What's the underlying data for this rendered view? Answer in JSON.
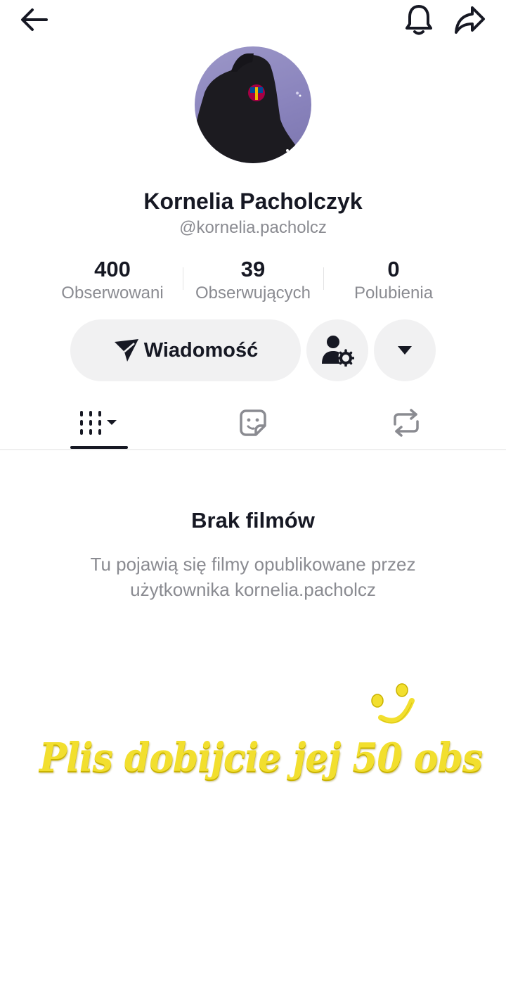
{
  "header": {
    "back_icon": "arrow-left-icon",
    "bell_icon": "bell-icon",
    "share_icon": "share-arrow-icon"
  },
  "profile": {
    "display_name": "Kornelia Pacholczyk",
    "username": "@kornelia.pacholcz"
  },
  "stats": [
    {
      "value": "400",
      "label": "Obserwowani"
    },
    {
      "value": "39",
      "label": "Obserwujących"
    },
    {
      "value": "0",
      "label": "Polubienia"
    }
  ],
  "actions": {
    "message_label": "Wiadomość"
  },
  "tabs": [
    {
      "icon": "videos-grid-icon"
    },
    {
      "icon": "sticker-icon"
    },
    {
      "icon": "repost-icon"
    }
  ],
  "empty_state": {
    "title": "Brak filmów",
    "description": "Tu pojawią się filmy opublikowane przez użytkownika kornelia.pacholcz"
  },
  "overlay": {
    "text": "Plis dobijcie jej 50 obs"
  },
  "colors": {
    "accent_yellow": "#f2df2e",
    "text_primary": "#161823",
    "text_secondary": "#8a8b91",
    "button_bg": "#f1f1f2"
  }
}
